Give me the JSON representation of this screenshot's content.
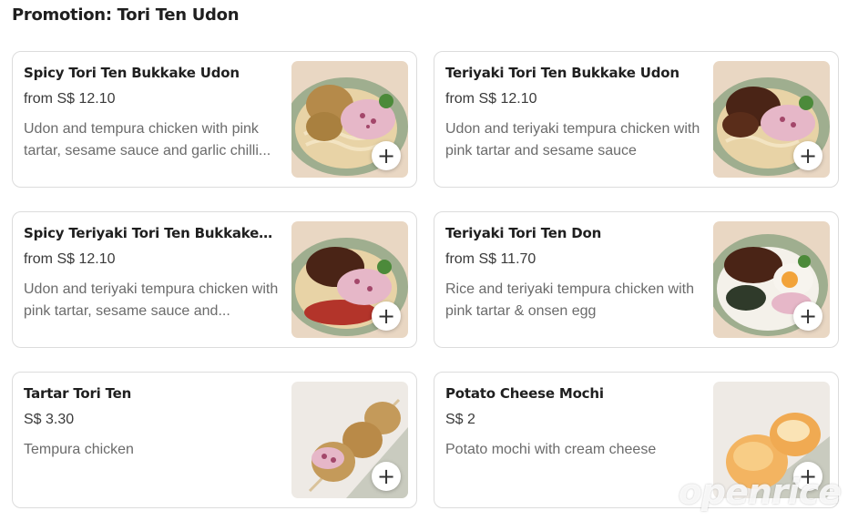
{
  "section": {
    "title": "Promotion: Tori Ten Udon"
  },
  "items": [
    {
      "name": "Spicy Tori Ten Bukkake Udon",
      "price": "from S$ 12.10",
      "description": "Udon and tempura chicken with pink tartar, sesame sauce and garlic chilli...",
      "image": "udon-bowl",
      "add_icon": "plus-icon"
    },
    {
      "name": "Teriyaki Tori Ten Bukkake Udon",
      "price": "from S$ 12.10",
      "description": "Udon and teriyaki tempura chicken with pink tartar and sesame sauce",
      "image": "udon-bowl",
      "add_icon": "plus-icon"
    },
    {
      "name": "Spicy Teriyaki Tori Ten Bukkake Ud...",
      "price": "from S$ 12.10",
      "description": "Udon and teriyaki tempura chicken with pink tartar, sesame sauce and...",
      "image": "udon-bowl",
      "add_icon": "plus-icon"
    },
    {
      "name": "Teriyaki Tori Ten Don",
      "price": "from S$ 11.70",
      "description": "Rice and teriyaki tempura chicken with pink tartar & onsen egg",
      "image": "rice-bowl",
      "add_icon": "plus-icon"
    },
    {
      "name": "Tartar Tori Ten",
      "price": "S$ 3.30",
      "description": "Tempura chicken",
      "image": "chicken-skewer",
      "add_icon": "plus-icon"
    },
    {
      "name": "Potato Cheese Mochi",
      "price": "S$ 2",
      "description": "Potato mochi with cream cheese",
      "image": "mochi",
      "add_icon": "plus-icon"
    }
  ],
  "add_button_glyph": "+",
  "watermark": "openrice"
}
